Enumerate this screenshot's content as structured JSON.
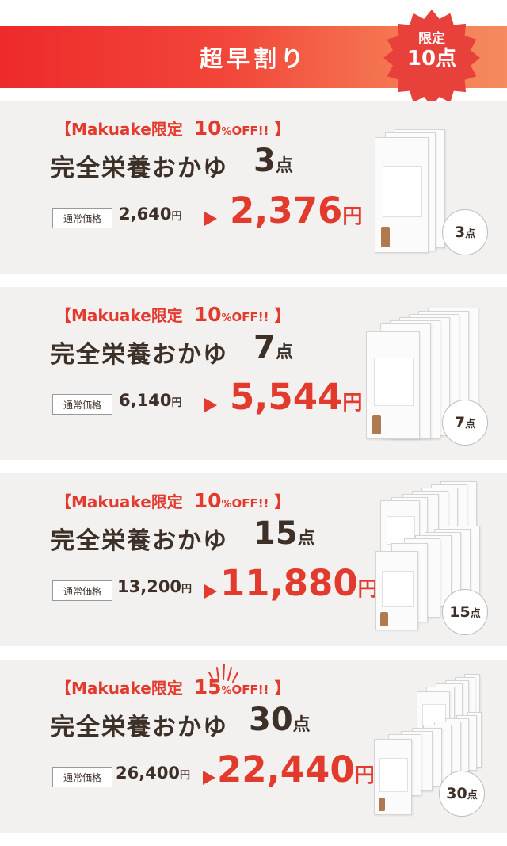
{
  "banner": {
    "title": "超早割り"
  },
  "badge": {
    "line1": "限定",
    "line2": "10点"
  },
  "colors": {
    "accent": "#e23b2e",
    "banner_start": "#ee2a2a",
    "banner_end": "#f58a5e",
    "text_dark": "#3d3028",
    "card_bg": "#f3f1ef"
  },
  "plans": [
    {
      "promo_open": "【Makuake限定",
      "discount_num": "10",
      "discount_unit": "%",
      "discount_off": "OFF!!",
      "promo_close": "】",
      "product_name": "完全栄養おかゆ",
      "qty_num": "3",
      "qty_unit": "点",
      "regular_label": "通常価格",
      "regular_price": "2,640",
      "regular_unit": "円",
      "sale_price": "2,376",
      "sale_unit": "円",
      "circle_num": "3",
      "circle_unit": "点",
      "image_icon": "product-pack-image"
    },
    {
      "promo_open": "【Makuake限定",
      "discount_num": "10",
      "discount_unit": "%",
      "discount_off": "OFF!!",
      "promo_close": "】",
      "product_name": "完全栄養おかゆ",
      "qty_num": "7",
      "qty_unit": "点",
      "regular_label": "通常価格",
      "regular_price": "6,140",
      "regular_unit": "円",
      "sale_price": "5,544",
      "sale_unit": "円",
      "circle_num": "7",
      "circle_unit": "点",
      "image_icon": "product-pack-image"
    },
    {
      "promo_open": "【Makuake限定",
      "discount_num": "10",
      "discount_unit": "%",
      "discount_off": "OFF!!",
      "promo_close": "】",
      "product_name": "完全栄養おかゆ",
      "qty_num": "15",
      "qty_unit": "点",
      "regular_label": "通常価格",
      "regular_price": "13,200",
      "regular_unit": "円",
      "sale_price": "11,880",
      "sale_unit": "円",
      "circle_num": "15",
      "circle_unit": "点",
      "image_icon": "product-pack-image"
    },
    {
      "promo_open": "【Makuake限定",
      "discount_num": "15",
      "discount_unit": "%",
      "discount_off": "OFF!!",
      "promo_close": "】",
      "product_name": "完全栄養おかゆ",
      "qty_num": "30",
      "qty_unit": "点",
      "regular_label": "通常価格",
      "regular_price": "26,400",
      "regular_unit": "円",
      "sale_price": "22,440",
      "sale_unit": "円",
      "circle_num": "30",
      "circle_unit": "点",
      "image_icon": "product-pack-image"
    }
  ]
}
